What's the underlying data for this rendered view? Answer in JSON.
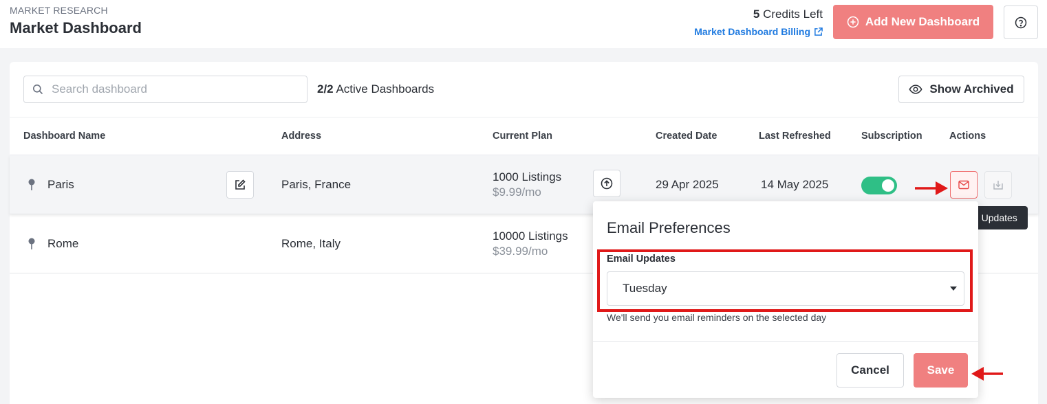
{
  "header": {
    "eyebrow": "MARKET RESEARCH",
    "title": "Market Dashboard",
    "credits_count": "5",
    "credits_label": "Credits Left",
    "billing_link": "Market Dashboard Billing",
    "add_button": "Add New Dashboard"
  },
  "toolbar": {
    "search_placeholder": "Search dashboard",
    "active_count": "2/2",
    "active_label": "Active Dashboards",
    "show_archived": "Show Archived"
  },
  "table": {
    "columns": [
      "Dashboard Name",
      "Address",
      "Current Plan",
      "Created Date",
      "Last Refreshed",
      "Subscription",
      "Actions"
    ],
    "rows": [
      {
        "name": "Paris",
        "address": "Paris, France",
        "plan": "1000 Listings",
        "price": "$9.99/mo",
        "created": "29 Apr 2025",
        "refreshed": "14 May 2025",
        "subscribed": true
      },
      {
        "name": "Rome",
        "address": "Rome, Italy",
        "plan": "10000 Listings",
        "price": "$39.99/mo"
      }
    ]
  },
  "tooltip": "Configure Email Updates",
  "popover": {
    "title": "Email Preferences",
    "field_label": "Email Updates",
    "selected_value": "Tuesday",
    "help_text": "We'll send you email reminders on the selected day",
    "cancel": "Cancel",
    "save": "Save"
  },
  "colors": {
    "accent": "#f08080",
    "link": "#1f7ae0",
    "toggle_on": "#2fbf86",
    "annotation": "#e01919"
  }
}
